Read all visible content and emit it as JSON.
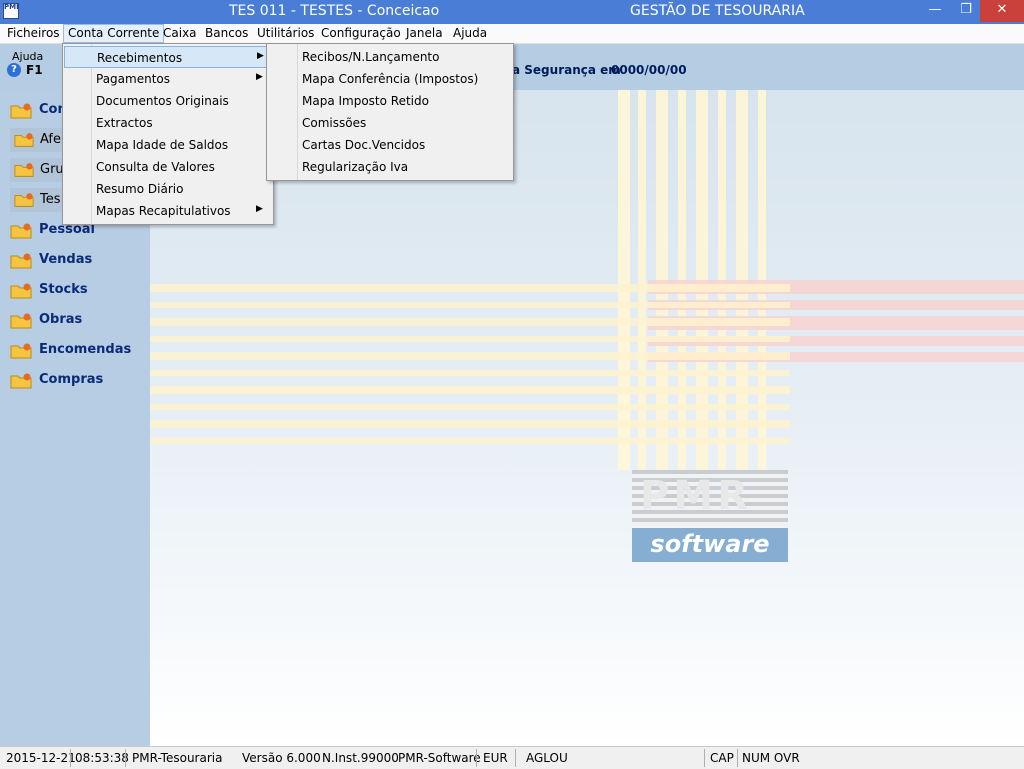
{
  "titlebar": {
    "app_icon_text": "PMR",
    "title": "TES 011 - TESTES - Conceicao",
    "right_title": "GESTÃO DE TESOURARIA",
    "minimize": "—",
    "maximize": "❐",
    "close": "✕"
  },
  "menubar": {
    "items": [
      "Ficheiros",
      "Conta Corrente",
      "Caixa",
      "Bancos",
      "Utilitários",
      "Configuração",
      "Janela",
      "Ajuda"
    ]
  },
  "toolbar": {
    "help_label": "Ajuda",
    "help_icon": "?",
    "help_key": "F1",
    "security_text": "a Segurança em",
    "security_date": "0000/00/00"
  },
  "sidebar": {
    "items": [
      {
        "label": "Conta",
        "icon": "folder-icon"
      },
      {
        "label": "Afe",
        "icon": "folder-icon"
      },
      {
        "label": "Gru",
        "icon": "folder-icon"
      },
      {
        "label": "Tes",
        "icon": "folder-icon"
      },
      {
        "label": "Pessoal",
        "icon": "folder-icon"
      },
      {
        "label": "Vendas",
        "icon": "folder-icon"
      },
      {
        "label": "Stocks",
        "icon": "folder-icon"
      },
      {
        "label": "Obras",
        "icon": "folder-icon"
      },
      {
        "label": "Encomendas",
        "icon": "folder-icon"
      },
      {
        "label": "Compras",
        "icon": "folder-icon"
      }
    ]
  },
  "dropdown": {
    "items": [
      {
        "label": "Recebimentos",
        "has_submenu": true
      },
      {
        "label": "Pagamentos",
        "has_submenu": true
      },
      {
        "label": "Documentos Originais",
        "has_submenu": false
      },
      {
        "label": "Extractos",
        "has_submenu": false
      },
      {
        "label": "Mapa Idade de Saldos",
        "has_submenu": false
      },
      {
        "label": "Consulta de Valores",
        "has_submenu": false
      },
      {
        "label": "Resumo Diário",
        "has_submenu": false
      },
      {
        "label": "Mapas  Recapitulativos",
        "has_submenu": true
      }
    ],
    "arrow": "▶"
  },
  "submenu": {
    "items": [
      "Recibos/N.Lançamento",
      "Mapa Conferência (Impostos)",
      "Mapa Imposto Retido",
      "Comissões",
      "Cartas Doc.Vencidos",
      "Regularização Iva"
    ]
  },
  "logo": {
    "top": "PMR",
    "bottom": "software"
  },
  "statusbar": {
    "date": "2015-12-21",
    "time": "08:53:38",
    "app": "PMR-Tesouraria",
    "version": "Versão  6.000",
    "inst": "N.Inst.99000",
    "vendor": "PMR-Software",
    "currency": "EUR",
    "user": "AGLOU",
    "cap": "CAP",
    "num_ovr": "NUM OVR"
  },
  "colors": {
    "titlebar": "#4a7dd6",
    "sidebar": "#b7cde3",
    "sidebar_text": "#0a2a7a",
    "highlight": "#d6e7f7",
    "close_button": "#c9413a",
    "logo_blue": "#86aed3"
  }
}
